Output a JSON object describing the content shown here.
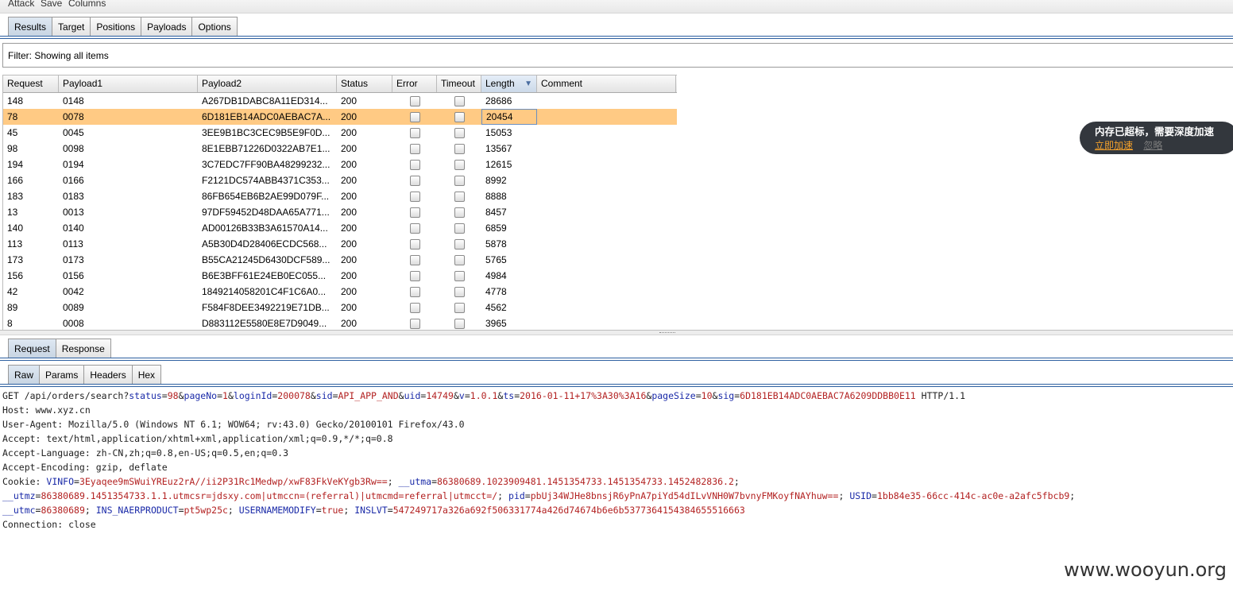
{
  "menu": [
    "Attack",
    "Save",
    "Columns"
  ],
  "tabs": [
    {
      "label": "Results",
      "active": true
    },
    {
      "label": "Target",
      "active": false
    },
    {
      "label": "Positions",
      "active": false
    },
    {
      "label": "Payloads",
      "active": false
    },
    {
      "label": "Options",
      "active": false
    }
  ],
  "filter_text": "Filter: Showing all items",
  "table": {
    "columns": [
      "Request",
      "Payload1",
      "Payload2",
      "Status",
      "Error",
      "Timeout",
      "Length",
      "Comment"
    ],
    "sorted_column": "Length",
    "sort_direction": "descending",
    "rows": [
      {
        "request": "148",
        "payload1": "0148",
        "payload2": "A267DB1DABC8A11ED314...",
        "status": "200",
        "length": "28686",
        "comment": "",
        "selected": false
      },
      {
        "request": "78",
        "payload1": "0078",
        "payload2": "6D181EB14ADC0AEBAC7A...",
        "status": "200",
        "length": "20454",
        "comment": "",
        "selected": true
      },
      {
        "request": "45",
        "payload1": "0045",
        "payload2": "3EE9B1BC3CEC9B5E9F0D...",
        "status": "200",
        "length": "15053",
        "comment": "",
        "selected": false
      },
      {
        "request": "98",
        "payload1": "0098",
        "payload2": "8E1EBB71226D0322AB7E1...",
        "status": "200",
        "length": "13567",
        "comment": "",
        "selected": false
      },
      {
        "request": "194",
        "payload1": "0194",
        "payload2": "3C7EDC7FF90BA48299232...",
        "status": "200",
        "length": "12615",
        "comment": "",
        "selected": false
      },
      {
        "request": "166",
        "payload1": "0166",
        "payload2": "F2121DC574ABB4371C353...",
        "status": "200",
        "length": "8992",
        "comment": "",
        "selected": false
      },
      {
        "request": "183",
        "payload1": "0183",
        "payload2": "86FB654EB6B2AE99D079F...",
        "status": "200",
        "length": "8888",
        "comment": "",
        "selected": false
      },
      {
        "request": "13",
        "payload1": "0013",
        "payload2": "97DF59452D48DAA65A771...",
        "status": "200",
        "length": "8457",
        "comment": "",
        "selected": false
      },
      {
        "request": "140",
        "payload1": "0140",
        "payload2": "AD00126B33B3A61570A14...",
        "status": "200",
        "length": "6859",
        "comment": "",
        "selected": false
      },
      {
        "request": "113",
        "payload1": "0113",
        "payload2": "A5B30D4D28406ECDC568...",
        "status": "200",
        "length": "5878",
        "comment": "",
        "selected": false
      },
      {
        "request": "173",
        "payload1": "0173",
        "payload2": "B55CA21245D6430DCF589...",
        "status": "200",
        "length": "5765",
        "comment": "",
        "selected": false
      },
      {
        "request": "156",
        "payload1": "0156",
        "payload2": "B6E3BFF61E24EB0EC055...",
        "status": "200",
        "length": "4984",
        "comment": "",
        "selected": false
      },
      {
        "request": "42",
        "payload1": "0042",
        "payload2": "1849214058201C4F1C6A0...",
        "status": "200",
        "length": "4778",
        "comment": "",
        "selected": false
      },
      {
        "request": "89",
        "payload1": "0089",
        "payload2": "F584F8DEE3492219E71DB...",
        "status": "200",
        "length": "4562",
        "comment": "",
        "selected": false
      },
      {
        "request": "8",
        "payload1": "0008",
        "payload2": "D883112E5580E8E7D9049...",
        "status": "200",
        "length": "3965",
        "comment": "",
        "selected": false
      }
    ]
  },
  "req_resp_tabs": [
    {
      "label": "Request",
      "active": true
    },
    {
      "label": "Response",
      "active": false
    }
  ],
  "view_tabs": [
    {
      "label": "Raw",
      "active": true
    },
    {
      "label": "Params",
      "active": false
    },
    {
      "label": "Headers",
      "active": false
    },
    {
      "label": "Hex",
      "active": false
    }
  ],
  "raw_request": {
    "request_line": {
      "prefix": "GET /api/orders/search?",
      "params": [
        {
          "key": "status",
          "value": "98"
        },
        {
          "key": "pageNo",
          "value": "1"
        },
        {
          "key": "loginId",
          "value": "200078"
        },
        {
          "key": "sid",
          "value": "API_APP_AND"
        },
        {
          "key": "uid",
          "value": "14749"
        },
        {
          "key": "v",
          "value": "1.0.1"
        },
        {
          "key": "ts",
          "value": "2016-01-11+17%3A30%3A16"
        },
        {
          "key": "pageSize",
          "value": "10"
        },
        {
          "key": "sig",
          "value": "6D181EB14ADC0AEBAC7A6209DDBB0E11"
        }
      ],
      "suffix": " HTTP/1.1"
    },
    "headers": [
      "Host: www.xyz.cn",
      "User-Agent: Mozilla/5.0 (Windows NT 6.1; WOW64; rv:43.0) Gecko/20100101 Firefox/43.0",
      "Accept: text/html,application/xhtml+xml,application/xml;q=0.9,*/*;q=0.8",
      "Accept-Language: zh-CN,zh;q=0.8,en-US;q=0.5,en;q=0.3",
      "Accept-Encoding: gzip, deflate"
    ],
    "cookie_label": "Cookie: ",
    "cookies": [
      {
        "key": "VINFO",
        "value": "3Eyaqee9mSWuiYREuz2rA//ii2P31Rc1Medwp/xwF83FkVeKYgb3Rw=="
      },
      {
        "key": "__utma",
        "value": "86380689.1023909481.1451354733.1451354733.1452482836.2"
      },
      {
        "key": "__utmz",
        "value": "86380689.1451354733.1.1.utmcsr=jdsxy.com|utmccn=(referral)|utmcmd=referral|utmcct=/"
      },
      {
        "key": "pid",
        "value": "pbUj34WJHe8bnsjR6yPnA7piYd54dILvVNH0W7bvnyFMKoyfNAYhuw=="
      },
      {
        "key": "USID",
        "value": "1bb84e35-66cc-414c-ac0e-a2afc5fbcb9"
      },
      {
        "key": "__utmc",
        "value": "86380689"
      },
      {
        "key": "INS_NAERPRODUCT",
        "value": "pt5wp25c"
      },
      {
        "key": "USERNAMEMODIFY",
        "value": "true"
      },
      {
        "key": "INSLVT",
        "value": "547249717a326a692f506331774a426d74674b6e6b5377364154384655516663"
      }
    ],
    "connection": "Connection: close"
  },
  "popup": {
    "title": "内存已超标，需要深度加速",
    "action_label": "立即加速",
    "ignore_label": "忽略"
  },
  "watermark": "www.wooyun.org",
  "colors": {
    "selected_row": "#ffca84",
    "param_key": "#1a2aa8",
    "param_value": "#b32222",
    "tab_rule": "#2c5fa0"
  }
}
